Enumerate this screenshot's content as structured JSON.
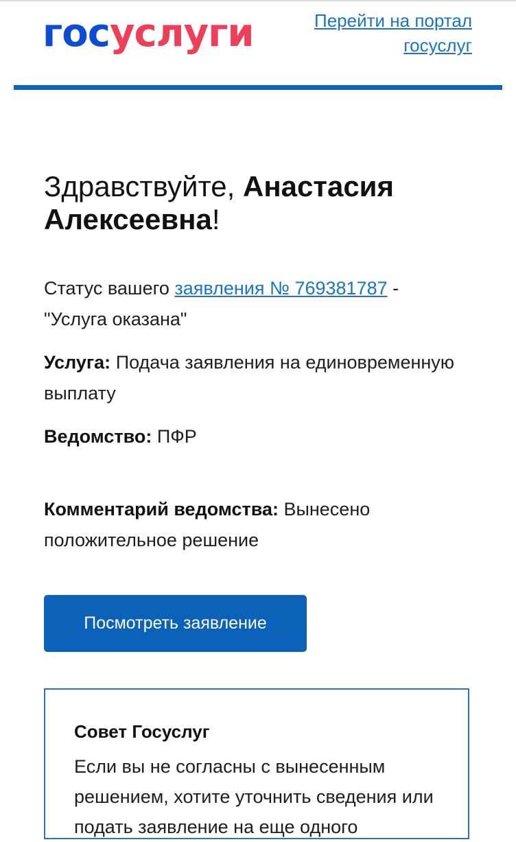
{
  "header": {
    "logo_part1": "гос",
    "logo_part2": "услуги",
    "portal_link_line1": "Перейти на портал",
    "portal_link_line2": "госуслуг"
  },
  "greeting": {
    "prefix": "Здравствуйте, ",
    "name": "Анастасия Алексеевна",
    "suffix": "!"
  },
  "status": {
    "prefix": "Статус вашего ",
    "link_text": "заявления № 769381787",
    "suffix": " -",
    "value": "\"Услуга оказана\""
  },
  "service": {
    "label": "Услуга:",
    "value": " Подача заявления на единовременную выплату"
  },
  "department": {
    "label": "Ведомство:",
    "value": " ПФР"
  },
  "comment": {
    "label": "Комментарий ведомства:",
    "value": " Вынесено положительное решение"
  },
  "view_button_label": "Посмотреть заявление",
  "tip": {
    "title": "Совет Госуслуг",
    "text": "Если вы не согласны с вынесенным решением, хотите уточнить сведения или подать заявление на еще одного"
  },
  "colors": {
    "brand_blue": "#0d4cd3",
    "brand_red": "#ee3f58",
    "link": "#1a73c9",
    "button": "#0b62b8"
  }
}
